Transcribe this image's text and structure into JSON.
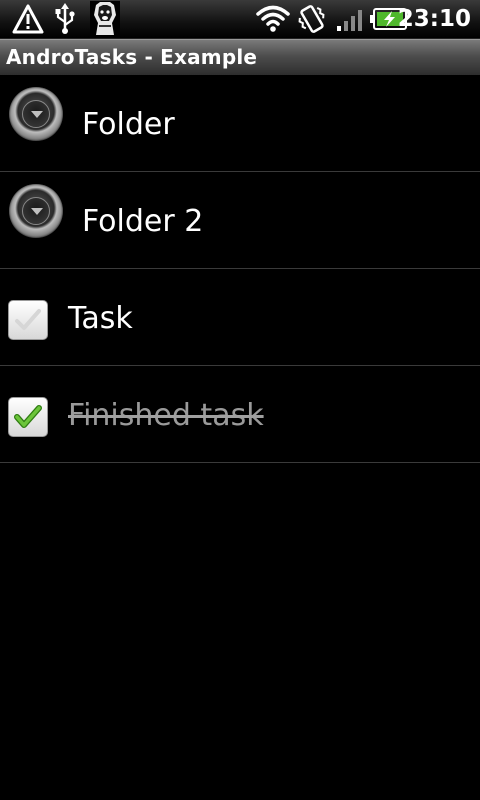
{
  "status_bar": {
    "time": "23:10",
    "icons": [
      "warning-icon",
      "usb-icon",
      "dog-avatar-icon",
      "wifi-icon",
      "vibrate-icon",
      "signal-icon",
      "battery-charging-icon"
    ]
  },
  "app": {
    "title": "AndroTasks - Example"
  },
  "list": {
    "folders": [
      {
        "label": "Folder",
        "icon": "expand-arrow-icon"
      },
      {
        "label": "Folder 2",
        "icon": "expand-arrow-icon"
      }
    ],
    "tasks": [
      {
        "label": "Task",
        "checked": false
      },
      {
        "label": "Finished task",
        "checked": true
      }
    ]
  },
  "colors": {
    "background": "#000000",
    "divider": "#3a3a3a",
    "check_green": "#5cb82e",
    "finished_text": "#9a9a9a"
  }
}
